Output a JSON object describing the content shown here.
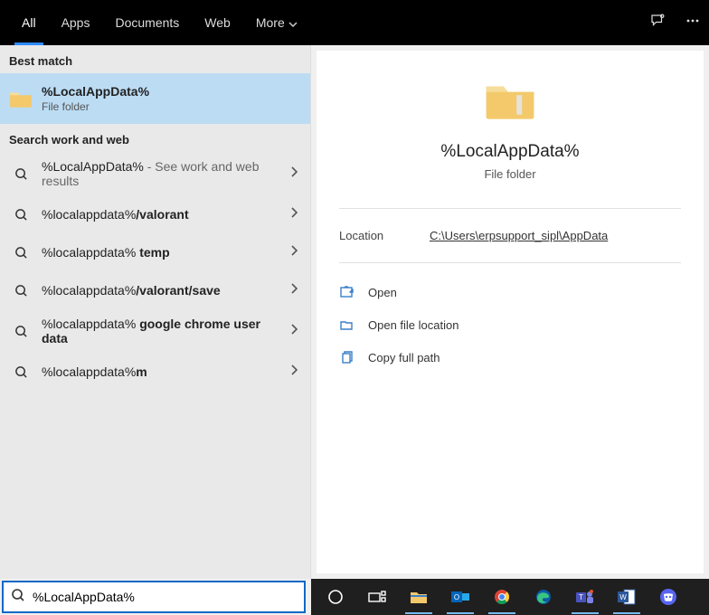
{
  "tabs": {
    "all": "All",
    "apps": "Apps",
    "documents": "Documents",
    "web": "Web",
    "more": "More"
  },
  "sections": {
    "best": "Best match",
    "workweb": "Search work and web"
  },
  "best": {
    "title": "%LocalAppData%",
    "sub": "File folder"
  },
  "suggestions": [
    {
      "prefix": "%LocalAppData%",
      "suffix": " - See work and web results"
    },
    {
      "prefix": "%localappdata%",
      "bold": "/valorant"
    },
    {
      "prefix": "%localappdata% ",
      "bold": "temp"
    },
    {
      "prefix": "%localappdata%",
      "bold": "/valorant/save"
    },
    {
      "prefix": "%localappdata% ",
      "bold": "google chrome user data"
    },
    {
      "prefix": "%localappdata%",
      "bold": "m"
    }
  ],
  "preview": {
    "title": "%LocalAppData%",
    "sub": "File folder",
    "location_label": "Location",
    "location_value": "C:\\Users\\erpsupport_sipl\\AppData"
  },
  "actions": {
    "open": "Open",
    "openloc": "Open file location",
    "copy": "Copy full path"
  },
  "search": {
    "value": "%LocalAppData%"
  }
}
